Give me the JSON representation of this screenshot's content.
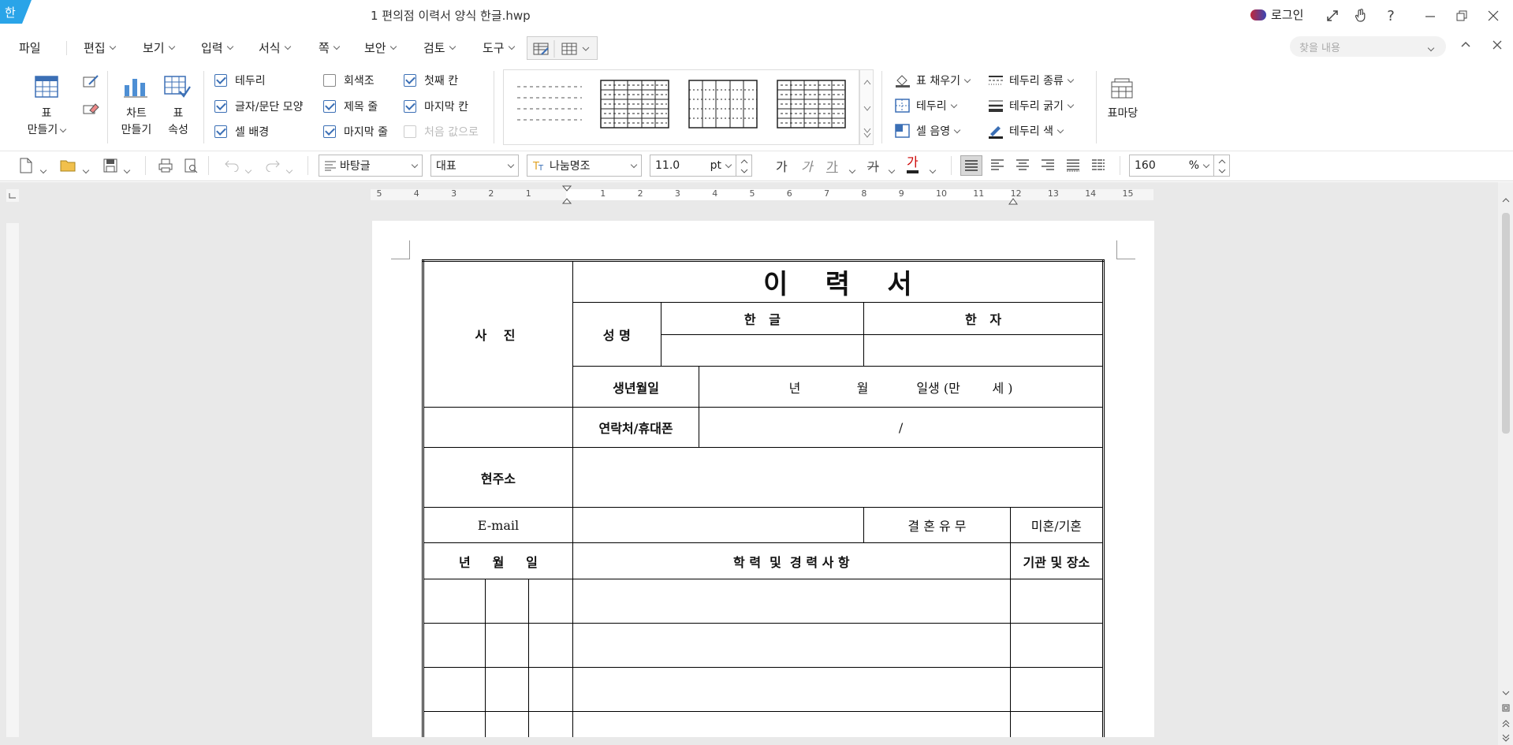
{
  "titlebar": {
    "logo_glyph": "한",
    "doc_title": "1 편의점 이력서 양식 한글.hwp",
    "login_label": "로그인",
    "help": "?"
  },
  "menu": {
    "items": [
      "파일",
      "편집",
      "보기",
      "입력",
      "서식",
      "쪽",
      "보안",
      "검토",
      "도구"
    ],
    "search_placeholder": "찾을 내용"
  },
  "ribbon": {
    "table_make": [
      "표",
      "만들기"
    ],
    "chart_make": [
      "차트",
      "만들기"
    ],
    "table_props": [
      "표",
      "속성"
    ],
    "checkboxes": [
      {
        "label": "테두리",
        "checked": true
      },
      {
        "label": "글자/문단 모양",
        "checked": true
      },
      {
        "label": "셀 배경",
        "checked": true
      },
      {
        "label": "회색조",
        "checked": false
      },
      {
        "label": "제목 줄",
        "checked": true
      },
      {
        "label": "마지막 줄",
        "checked": true
      },
      {
        "label": "첫째 칸",
        "checked": true
      },
      {
        "label": "마지막 칸",
        "checked": true
      },
      {
        "label": "처음 값으로",
        "checked": false,
        "disabled": true
      }
    ],
    "right_tools": [
      "표 채우기",
      "테두리",
      "셀 음영",
      "테두리 종류",
      "테두리 굵기",
      "테두리 색"
    ],
    "table_madang": "표마당"
  },
  "format_bar": {
    "style": "바탕글",
    "lang": "대표",
    "font": "나눔명조",
    "size": "11.0",
    "unit": "pt",
    "char_glyphs": [
      "가",
      "가",
      "가",
      "가",
      "가"
    ],
    "zoom": "160",
    "zoom_unit": "%"
  },
  "ruler": {
    "h_numbers": [
      "5",
      "4",
      "3",
      "2",
      "1",
      "1",
      "2",
      "3",
      "4",
      "5",
      "6",
      "7",
      "8",
      "9",
      "10",
      "11",
      "12",
      "13",
      "14",
      "15"
    ]
  },
  "resume": {
    "title": "이    력    서",
    "photo": "사   진",
    "name": "성 명",
    "hangul": "한   글",
    "hanja": "한   자",
    "birth": "생년월일",
    "birth_fill": "년              월            일생 (만        세 )",
    "contact": "연락처/휴대폰",
    "contact_fill": "/",
    "address": "현주소",
    "email": "E-mail",
    "marriage": "결 혼 유 무",
    "marriage_val": "미혼/기혼",
    "ymd": "년     월     일",
    "history": "학 력  및  경 력 사 항",
    "org": "기관 및 장소"
  }
}
